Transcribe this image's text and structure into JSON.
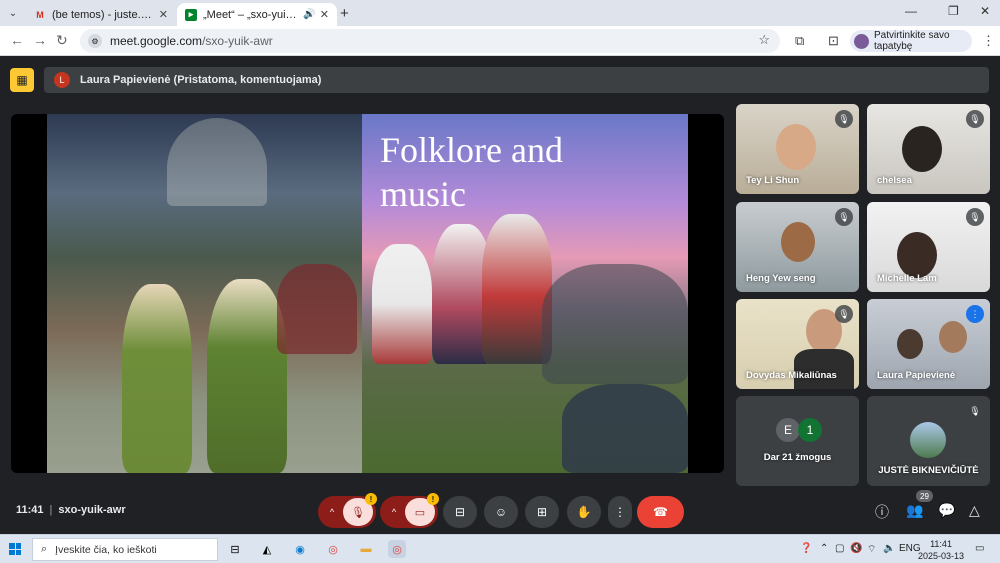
{
  "browser": {
    "tabs": [
      {
        "title": "(be temos) - juste.bikneviciute@",
        "favicon": "gmail-icon",
        "active": false
      },
      {
        "title": "„Meet“ – „sxo-yuik-awr“",
        "favicon": "meet-icon",
        "active": true
      }
    ],
    "new_tab": "+",
    "url_host": "meet.google.com",
    "url_path": "/sxo-yuik-awr",
    "profile_button": "Patvirtinkite savo tapatybę"
  },
  "meet": {
    "presenter_initial": "L",
    "presenter_label": "Laura Papievienė (Pristatoma, komentuojama)",
    "slide": {
      "title_line1": "Folklore and",
      "title_line2": "music"
    },
    "participants": [
      {
        "name": "Tey Li Shun",
        "muted": true
      },
      {
        "name": "chelsea",
        "muted": true
      },
      {
        "name": "Heng Yew seng",
        "muted": true
      },
      {
        "name": "Michelle Lam",
        "muted": true
      },
      {
        "name": "Dovydas Mikaliūnas",
        "muted": true
      },
      {
        "name": "Laura Papievienė",
        "muted": false,
        "speaking": true
      },
      {
        "name": "JUSTĖ BIKNEVIČIŪTĖ",
        "muted": true
      }
    ],
    "others": {
      "label": "Dar 21 žmogus",
      "avatars": [
        "E",
        "1"
      ]
    },
    "time": "11:41",
    "meeting_code": "sxo-yuik-awr",
    "people_count": "29",
    "colors": {
      "hangup": "#ea4335",
      "muted_bg": "#8c1d18",
      "muted_pill": "#f9dedc",
      "warning": "#fbbc04",
      "accent": "#8ab4f8"
    }
  },
  "taskbar": {
    "search_placeholder": "Įveskite čia, ko ieškoti",
    "language": "ENG",
    "clock_time": "11:41",
    "clock_date": "2025-03-13"
  }
}
